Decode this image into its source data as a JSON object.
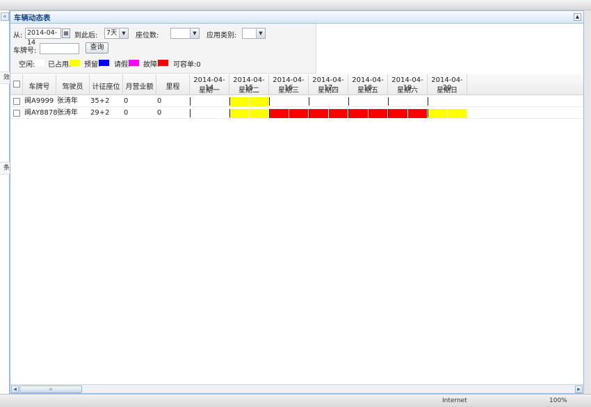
{
  "window": {
    "collapse_glyph": "«",
    "left_strip": [
      "效",
      "条"
    ],
    "status_zone": "Internet",
    "status_zoom": "100%"
  },
  "panel": {
    "title": "车辆动态表",
    "tool_glyph": "▲"
  },
  "filter": {
    "from_label": "从:",
    "from_value": "2014-04-14",
    "after_label": "到此后:",
    "after_value": "7天",
    "seats_label": "座位数:",
    "seats_value": "",
    "app_type_label": "应用类别:",
    "app_type_value": "",
    "plate_label": "车牌号:",
    "plate_value": "",
    "query_label": "查询",
    "legend": [
      {
        "label": "空闲:",
        "color": "#ffffff"
      },
      {
        "label": "已占用:",
        "color": "#ffff00"
      },
      {
        "label": "预留:",
        "color": "#0000ff"
      },
      {
        "label": "请假:",
        "color": "#ff00ff"
      },
      {
        "label": "故障:",
        "color": "#ff0000"
      }
    ],
    "available_label": "可容单:0"
  },
  "grid": {
    "columns": [
      "车牌号",
      "驾驶员",
      "计征座位",
      "月营业额",
      "里程"
    ],
    "dates": [
      {
        "date": "2014-04-14",
        "weekday": "星期一"
      },
      {
        "date": "2014-04-15",
        "weekday": "星期二"
      },
      {
        "date": "2014-04-16",
        "weekday": "星期三"
      },
      {
        "date": "2014-04-17",
        "weekday": "星期四"
      },
      {
        "date": "2014-04-18",
        "weekday": "星期五"
      },
      {
        "date": "2014-04-19",
        "weekday": "星期六"
      },
      {
        "date": "2014-04-20",
        "weekday": "星期日"
      }
    ],
    "rows": [
      {
        "plate": "闽A9999",
        "driver": "张涛年",
        "seats": "35+2",
        "monthly": "0",
        "mileage": "0",
        "status": [
          "free",
          "free",
          "occupied",
          "occupied",
          "free",
          "free",
          "free",
          "free",
          "free",
          "free",
          "free",
          "free",
          "free",
          "free"
        ]
      },
      {
        "plate": "闽AY8878",
        "driver": "张涛年",
        "seats": "29+2",
        "monthly": "0",
        "mileage": "0",
        "status": [
          "free",
          "free",
          "occupied",
          "occupied",
          "fault",
          "fault",
          "fault",
          "fault",
          "fault",
          "fault",
          "fault",
          "fault",
          "occupied",
          "occupied"
        ]
      }
    ]
  },
  "colors": {
    "free": "#ffffff",
    "occupied": "#ffff00",
    "reserved": "#0000ff",
    "leave": "#ff00ff",
    "fault": "#ff0000",
    "header_text": "#15428b"
  }
}
